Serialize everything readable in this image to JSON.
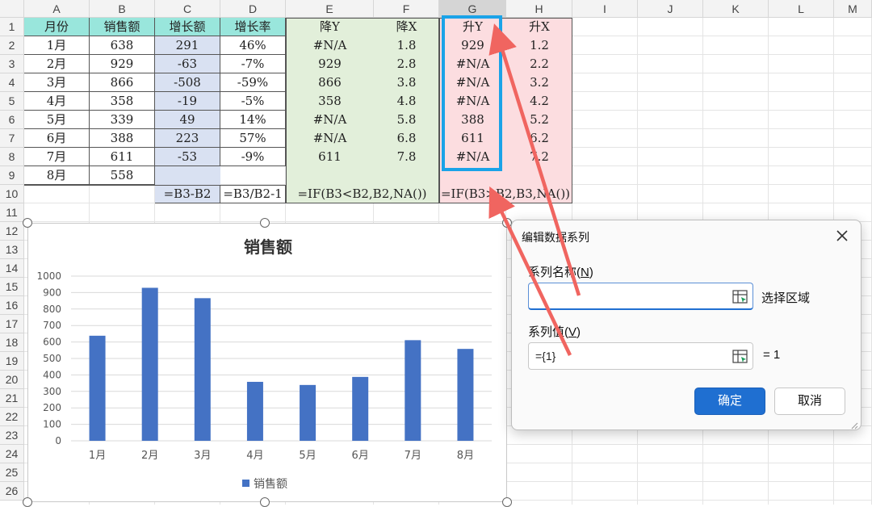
{
  "columns": [
    "A",
    "B",
    "C",
    "D",
    "E",
    "F",
    "G",
    "H",
    "I",
    "J",
    "K",
    "L",
    "M"
  ],
  "rows": [
    "1",
    "2",
    "3",
    "4",
    "5",
    "6",
    "7",
    "8",
    "9",
    "10",
    "11",
    "12",
    "13",
    "14",
    "15",
    "16",
    "17",
    "18",
    "19",
    "20",
    "21",
    "22",
    "23",
    "24",
    "25",
    "26"
  ],
  "table": {
    "headers": [
      "月份",
      "销售额",
      "增长额",
      "增长率",
      "降Y",
      "降X",
      "升Y",
      "升X"
    ],
    "data": [
      [
        "1月",
        "638",
        "291",
        "46%",
        "#N/A",
        "1.8",
        "929",
        "1.2"
      ],
      [
        "2月",
        "929",
        "-63",
        "-7%",
        "929",
        "2.8",
        "#N/A",
        "2.2"
      ],
      [
        "3月",
        "866",
        "-508",
        "-59%",
        "866",
        "3.8",
        "#N/A",
        "3.2"
      ],
      [
        "4月",
        "358",
        "-19",
        "-5%",
        "358",
        "4.8",
        "#N/A",
        "4.2"
      ],
      [
        "5月",
        "339",
        "49",
        "14%",
        "#N/A",
        "5.8",
        "388",
        "5.2"
      ],
      [
        "6月",
        "388",
        "223",
        "57%",
        "#N/A",
        "6.8",
        "611",
        "6.2"
      ],
      [
        "7月",
        "611",
        "-53",
        "-9%",
        "611",
        "7.8",
        "#N/A",
        "7.2"
      ],
      [
        "8月",
        "558",
        "",
        "",
        "",
        "",
        "",
        ""
      ]
    ],
    "formulas": {
      "c": "=B3-B2",
      "d": "=B3/B2-1",
      "e": "=IF(B3<B2,B2,NA())",
      "g": "=IF(B3>B2,B3,NA())"
    }
  },
  "chart_data": {
    "type": "bar",
    "title": "销售额",
    "categories": [
      "1月",
      "2月",
      "3月",
      "4月",
      "5月",
      "6月",
      "7月",
      "8月"
    ],
    "series": [
      {
        "name": "销售额",
        "values": [
          638,
          929,
          866,
          358,
          339,
          388,
          611,
          558
        ]
      }
    ],
    "ylim": [
      0,
      1000
    ],
    "yticks": [
      0,
      100,
      200,
      300,
      400,
      500,
      600,
      700,
      800,
      900,
      1000
    ],
    "grid": true,
    "legend": "bottom",
    "bar_color": "#4472c4"
  },
  "dialog": {
    "title": "编辑数据系列",
    "name_label": "系列名称(N)",
    "name_underline": "N",
    "name_value": "",
    "select_range": "选择区域",
    "values_label": "系列值(V)",
    "values_underline": "V",
    "values_value": "={1}",
    "values_result": "= 1",
    "ok": "确定",
    "cancel": "取消",
    "close_icon": "close-icon"
  },
  "colors": {
    "teal": "#99e6dc",
    "lavender": "#d9e1f2",
    "green": "#e2efda",
    "pink": "#fcdde0",
    "highlight": "#1aa3e8",
    "arrow": "#f06560",
    "primary": "#1f6fd1"
  }
}
